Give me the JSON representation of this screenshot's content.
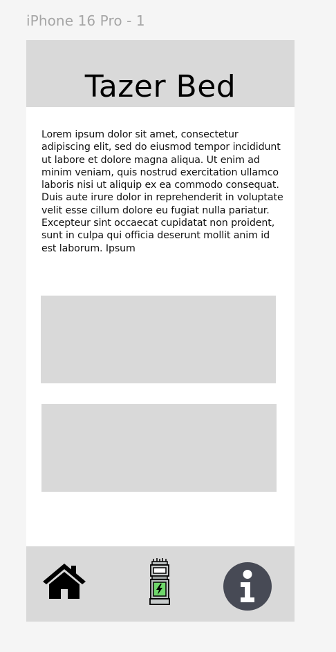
{
  "frame": {
    "label": "iPhone 16 Pro - 1"
  },
  "header": {
    "title": "Tazer Bed"
  },
  "content": {
    "paragraph": "Lorem ipsum dolor sit amet, consectetur adipiscing elit, sed do eiusmod tempor incididunt ut labore et dolore magna aliqua. Ut enim ad minim veniam, quis nostrud exercitation ullamco laboris nisi ut aliquip ex ea commodo consequat. Duis aute irure dolor in reprehenderit in voluptate velit esse cillum dolore eu fugiat nulla pariatur. Excepteur sint occaecat cupidatat non proident, sunt in culpa qui officia deserunt mollit anim id est laborum. Ipsum"
  },
  "nav": {
    "items": [
      {
        "icon": "home-icon"
      },
      {
        "icon": "tazer-icon"
      },
      {
        "icon": "info-icon"
      }
    ]
  },
  "colors": {
    "background": "#f5f5f5",
    "surface": "#ffffff",
    "panel": "#d9d9d9",
    "text": "#000000",
    "frame_label": "#a6a6a6",
    "info_icon": "#474a55",
    "tazer_accent": "#6fd66b"
  }
}
